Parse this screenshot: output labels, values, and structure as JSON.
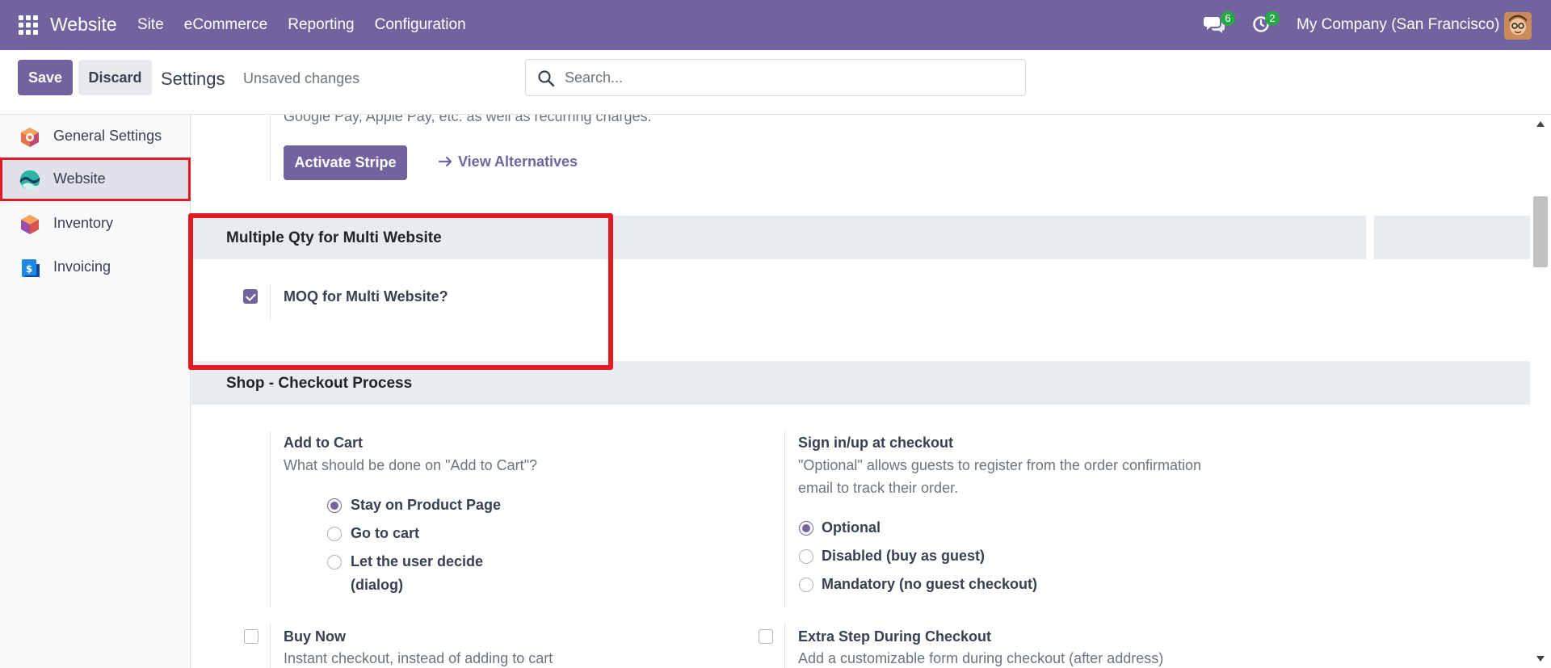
{
  "navbar": {
    "app_name": "Website",
    "menu": [
      "Site",
      "eCommerce",
      "Reporting",
      "Configuration"
    ],
    "messages_count": "6",
    "activities_count": "2",
    "company": "My Company (San Francisco)"
  },
  "control_panel": {
    "save_label": "Save",
    "discard_label": "Discard",
    "title": "Settings",
    "status": "Unsaved changes",
    "search_placeholder": "Search..."
  },
  "sidebar": {
    "items": [
      {
        "label": "General Settings",
        "icon": "odoo-icon"
      },
      {
        "label": "Website",
        "icon": "website-icon",
        "active": true
      },
      {
        "label": "Inventory",
        "icon": "inventory-icon"
      },
      {
        "label": "Invoicing",
        "icon": "invoicing-icon"
      }
    ]
  },
  "payment": {
    "desc_tail": "Google Pay, Apple Pay, etc. as well as recurring charges.",
    "activate_label": "Activate Stripe",
    "alternatives_label": "View Alternatives"
  },
  "multi_qty": {
    "section_title": "Multiple Qty for Multi Website",
    "moq_label": "MOQ for Multi Website?",
    "moq_checked": true
  },
  "checkout": {
    "section_title": "Shop - Checkout Process",
    "add_to_cart": {
      "title": "Add to Cart",
      "desc": "What should be done on \"Add to Cart\"?",
      "options": [
        "Stay on Product Page",
        "Go to cart",
        "Let the user decide",
        "(dialog)"
      ],
      "selected": 0
    },
    "sign_in": {
      "title": "Sign in/up at checkout",
      "desc_line1": "\"Optional\" allows guests to register from the order confirmation",
      "desc_line2": "email to track their order.",
      "options": [
        "Optional",
        "Disabled (buy as guest)",
        "Mandatory (no guest checkout)"
      ],
      "selected": 0
    },
    "buy_now": {
      "title": "Buy Now",
      "desc": "Instant checkout, instead of adding to cart"
    },
    "extra_step": {
      "title": "Extra Step During Checkout",
      "desc": "Add a customizable form during checkout (after address)"
    }
  },
  "colors": {
    "brand": "#71639e",
    "badge": "#28a745",
    "highlight": "#e01b24"
  }
}
